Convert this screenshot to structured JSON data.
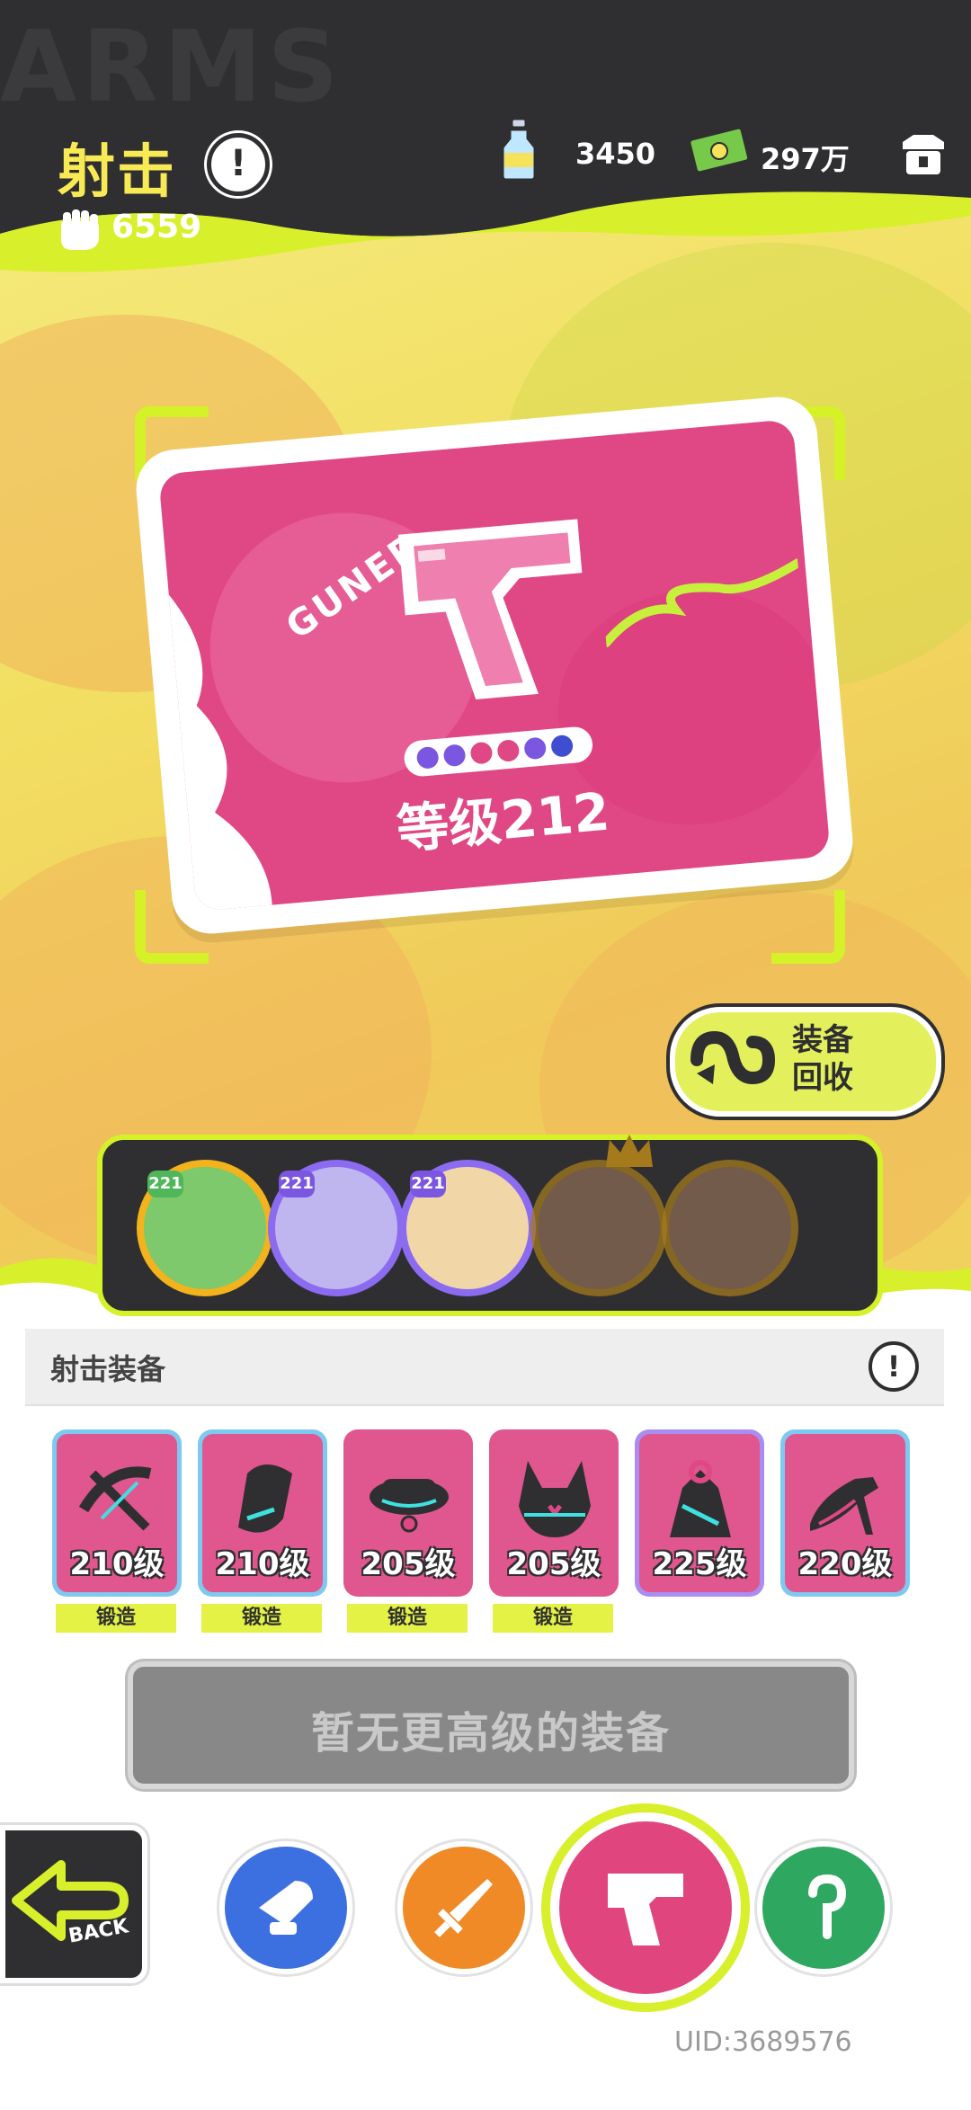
{
  "header": {
    "title": "射击",
    "title_info": "!",
    "power": "6559",
    "resources": [
      {
        "icon": "bottle-icon",
        "value": "3450"
      },
      {
        "icon": "cash-icon",
        "value": "297万"
      }
    ],
    "shop_icon": "shop-icon"
  },
  "card": {
    "class_label": "GUNER",
    "level_text": "等级212",
    "stars": 6
  },
  "recycle": {
    "label_line1": "装备",
    "label_line2": "回收"
  },
  "heroes": [
    {
      "badge": "221",
      "ring": "#f3b31d",
      "bg": "#7dc96b"
    },
    {
      "badge": "221",
      "ring": "#8b6bf0",
      "bg": "#bfb6ef"
    },
    {
      "badge": "221",
      "ring": "#8b6bf0",
      "bg": "#f1d7a8"
    },
    {
      "badge": "",
      "ring": "#a47a1c",
      "bg": "#b48fa0",
      "crown": true
    },
    {
      "badge": "",
      "ring": "#a47a1c",
      "bg": "#b68a78"
    }
  ],
  "equipment_section": {
    "title": "射击装备",
    "info": "!"
  },
  "equipment": [
    {
      "level": "210级",
      "forge": "锻造",
      "icon": "crossbow-icon",
      "frame": "#7ec9f0"
    },
    {
      "level": "210级",
      "forge": "锻造",
      "icon": "glove-icon",
      "frame": "#7ec9f0"
    },
    {
      "level": "205级",
      "forge": "锻造",
      "icon": "hat-icon",
      "frame": "#e0568e"
    },
    {
      "level": "205级",
      "forge": "锻造",
      "icon": "armor-icon",
      "frame": "#e0568e"
    },
    {
      "level": "225级",
      "forge": "",
      "icon": "dress-icon",
      "frame": "#a98ef2"
    },
    {
      "level": "220级",
      "forge": "",
      "icon": "shoe-icon",
      "frame": "#7ec9f0"
    }
  ],
  "no_better_label": "暂无更高级的装备",
  "back_label": "BACK",
  "nav": [
    {
      "icon": "cannon-icon",
      "color": "#3c6fe0"
    },
    {
      "icon": "sword-icon",
      "color": "#f08a26"
    },
    {
      "icon": "pistol-icon",
      "color": "#e0457e",
      "active": true
    },
    {
      "icon": "hook-icon",
      "color": "#2ea760"
    }
  ],
  "uid": "UID:3689576"
}
